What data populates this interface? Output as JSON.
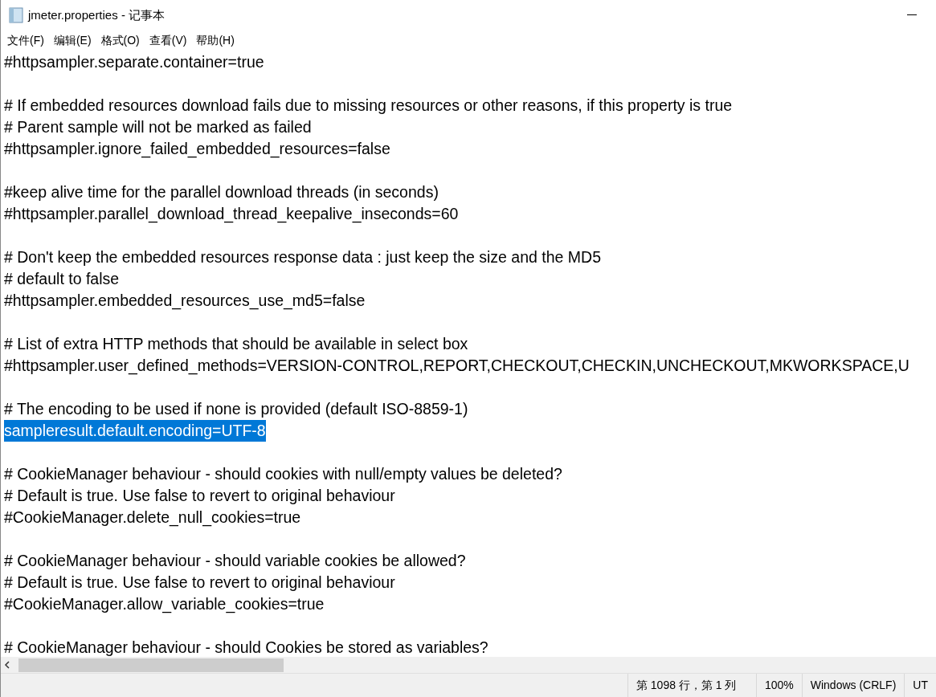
{
  "window": {
    "title": "jmeter.properties - 记事本"
  },
  "menu": [
    "文件(F)",
    "编辑(E)",
    "格式(O)",
    "查看(V)",
    "帮助(H)"
  ],
  "paragraphs": [
    {
      "lines": [
        {
          "text": "#httpsampler.separate.container=true",
          "selected": false
        }
      ]
    },
    {
      "lines": [
        {
          "text": "# If embedded resources download fails due to missing resources or other reasons, if this property is true",
          "selected": false
        },
        {
          "text": "# Parent sample will not be marked as failed",
          "selected": false
        },
        {
          "text": "#httpsampler.ignore_failed_embedded_resources=false",
          "selected": false
        }
      ]
    },
    {
      "lines": [
        {
          "text": "#keep alive time for the parallel download threads (in seconds)",
          "selected": false
        },
        {
          "text": "#httpsampler.parallel_download_thread_keepalive_inseconds=60",
          "selected": false
        }
      ]
    },
    {
      "lines": [
        {
          "text": "# Don't keep the embedded resources response data : just keep the size and the MD5",
          "selected": false
        },
        {
          "text": "# default to false",
          "selected": false
        },
        {
          "text": "#httpsampler.embedded_resources_use_md5=false",
          "selected": false
        }
      ]
    },
    {
      "lines": [
        {
          "text": "# List of extra HTTP methods that should be available in select box",
          "selected": false
        },
        {
          "text": "#httpsampler.user_defined_methods=VERSION-CONTROL,REPORT,CHECKOUT,CHECKIN,UNCHECKOUT,MKWORKSPACE,U",
          "selected": false
        }
      ]
    },
    {
      "lines": [
        {
          "text": "# The encoding to be used if none is provided (default ISO-8859-1)",
          "selected": false
        },
        {
          "text": "sampleresult.default.encoding=UTF-8",
          "selected": true
        }
      ]
    },
    {
      "lines": [
        {
          "text": "# CookieManager behaviour - should cookies with null/empty values be deleted?",
          "selected": false
        },
        {
          "text": "# Default is true. Use false to revert to original behaviour",
          "selected": false
        },
        {
          "text": "#CookieManager.delete_null_cookies=true",
          "selected": false
        }
      ]
    },
    {
      "lines": [
        {
          "text": "# CookieManager behaviour - should variable cookies be allowed?",
          "selected": false
        },
        {
          "text": "# Default is true. Use false to revert to original behaviour",
          "selected": false
        },
        {
          "text": "#CookieManager.allow_variable_cookies=true",
          "selected": false
        }
      ]
    },
    {
      "lines": [
        {
          "text": "# CookieManager behaviour - should Cookies be stored as variables?",
          "selected": false
        }
      ]
    }
  ],
  "status_bar": [
    "第 1098 行，第 1 列",
    "100%",
    "Windows (CRLF)",
    "UT"
  ]
}
